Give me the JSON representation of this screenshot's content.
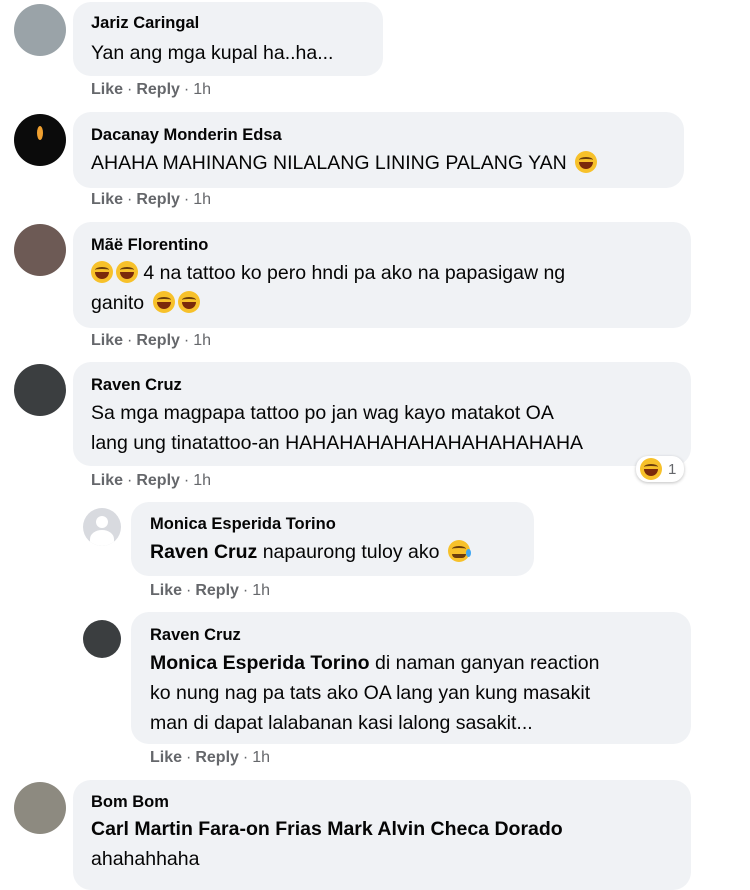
{
  "common": {
    "like": "Like",
    "reply": "Reply",
    "dot": "·"
  },
  "comments": [
    {
      "author": "Jariz Caringal",
      "lines": [
        "Yan ang mga kupal ha..ha..."
      ],
      "time": "1h",
      "avatar_color": "#9aa3a8"
    },
    {
      "author": "Dacanay Monderin Edsa",
      "lines": [
        "AHAHA MAHINANG NILALANG LINING PALANG YAN"
      ],
      "emoji": "laughing-tears-emoji",
      "time": "1h",
      "avatar_color": "#0b0b0b"
    },
    {
      "author": "Mãë Florentino",
      "lines": [
        "4 na tattoo ko pero hndi pa ako na papasigaw ng",
        "ganito"
      ],
      "emoji": "grinning-sweat-emoji",
      "time": "1h",
      "avatar_color": "#6d5a55"
    },
    {
      "author": "Raven Cruz",
      "lines": [
        "Sa mga magpapa tattoo po jan wag kayo matakot OA",
        "lang ung tinatattoo-an HAHAHAHAHAHAHAHAHAHAHA"
      ],
      "time": "1h",
      "reaction_count": "1",
      "avatar_color": "#3b3e40"
    }
  ],
  "replies": [
    {
      "author": "Monica Esperida Torino",
      "mention": "Raven Cruz",
      "lines": [
        "napaurong tuloy ako"
      ],
      "emoji": "crying-emoji",
      "time": "1h"
    },
    {
      "author": "Raven Cruz",
      "mention": "Monica Esperida Torino",
      "lines": [
        "di naman ganyan reaction",
        "ko nung nag pa tats ako OA lang yan kung masakit",
        "man di dapat lalabanan kasi lalong sasakit..."
      ],
      "time": "1h",
      "avatar_color": "#3b3e40"
    }
  ],
  "last_comment": {
    "author": "Bom Bom",
    "mention": "Carl Martin Fara-on Frias Mark Alvin Checa Dorado",
    "lines": [
      "ahahahhaha"
    ],
    "avatar_color": "#8d8a80"
  }
}
